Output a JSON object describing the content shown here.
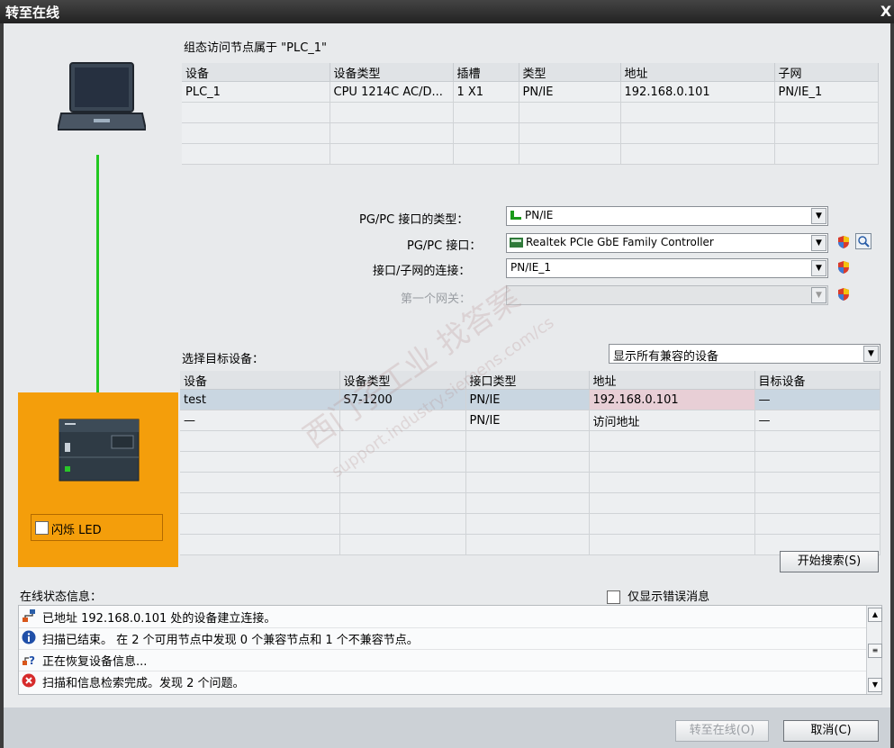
{
  "window": {
    "title": "转至在线",
    "close": "X"
  },
  "config": {
    "heading": "组态访问节点属于 \"PLC_1\"",
    "columns": [
      "设备",
      "设备类型",
      "插槽",
      "类型",
      "地址",
      "子网"
    ],
    "rows": [
      [
        "PLC_1",
        "CPU 1214C AC/D...",
        "1 X1",
        "PN/IE",
        "192.168.0.101",
        "PN/IE_1"
      ]
    ]
  },
  "iface": {
    "type_label": "PG/PC 接口的类型：",
    "type_value": "PN/IE",
    "pgpc_label": "PG/PC 接口：",
    "pgpc_value": "Realtek PCIe GbE Family Controller",
    "subnet_label": "接口/子网的连接：",
    "subnet_value": "PN/IE_1",
    "gateway_label": "第一个网关：",
    "gateway_value": ""
  },
  "target": {
    "label": "选择目标设备：",
    "filter_value": "显示所有兼容的设备",
    "columns": [
      "设备",
      "设备类型",
      "接口类型",
      "地址",
      "目标设备"
    ],
    "rows": [
      [
        "test",
        "S7-1200",
        "PN/IE",
        "192.168.0.101",
        "—"
      ],
      [
        "—",
        "",
        "PN/IE",
        "访问地址",
        "—"
      ]
    ]
  },
  "blink": {
    "label": "闪烁 LED"
  },
  "search_button": "开始搜索(S)",
  "status": {
    "label": "在线状态信息：",
    "only_errors_label": "仅显示错误消息",
    "messages": [
      {
        "icon": "connection-icon",
        "text": "已地址 192.168.0.101 处的设备建立连接。"
      },
      {
        "icon": "info-icon",
        "text": "扫描已结束。 在 2 个可用节点中发现 0 个兼容节点和 1 个不兼容节点。"
      },
      {
        "icon": "retrieve-icon",
        "text": "正在恢复设备信息..."
      },
      {
        "icon": "error-icon",
        "text": "扫描和信息检索完成。发现 2 个问题。"
      }
    ]
  },
  "buttons": {
    "go_online": "转至在线(O)",
    "cancel": "取消(C)"
  },
  "watermark": {
    "line1": "西门子工业 找答案",
    "line2": "support.industry.siemens.com/cs"
  },
  "colors": {
    "link_line": "#21c821",
    "plc_panel": "#f49e0b",
    "selected_row": "#c9d6e1",
    "address_highlight": "#e8cfd6"
  }
}
